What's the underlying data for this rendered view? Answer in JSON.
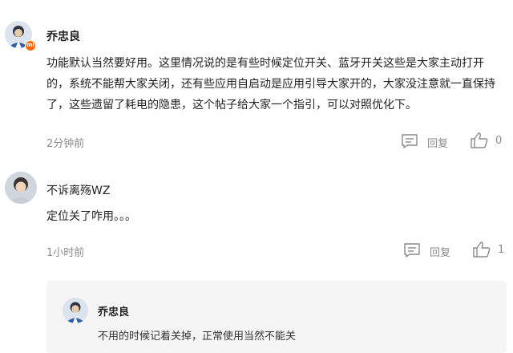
{
  "comments": [
    {
      "username": "乔忠良",
      "text": "功能默认当然要好用。这里情况说的是有些时候定位开关、蓝牙开关这些是大家主动打开的，系统不能帮大家关闭，还有些应用自启动是应用引导大家开的，大家没注意就一直保持了，这些遗留了耗电的隐患，这个帖子给大家一个指引，可以对照优化下。",
      "time": "2分钟前",
      "reply_label": "回复",
      "like_count": "0",
      "badge": "mi"
    },
    {
      "username": "不诉离殇WZ",
      "text": "定位关了咋用。。。",
      "time": "1小时前",
      "reply_label": "回复",
      "like_count": "1"
    }
  ],
  "nested_reply": {
    "username": "乔忠良",
    "text": "不用的时候记着关掉，正常使用当然不能关"
  },
  "colors": {
    "accent_badge": "#ff6900",
    "muted_text": "#8a8a8a",
    "nested_bg": "#f5f5f5"
  }
}
